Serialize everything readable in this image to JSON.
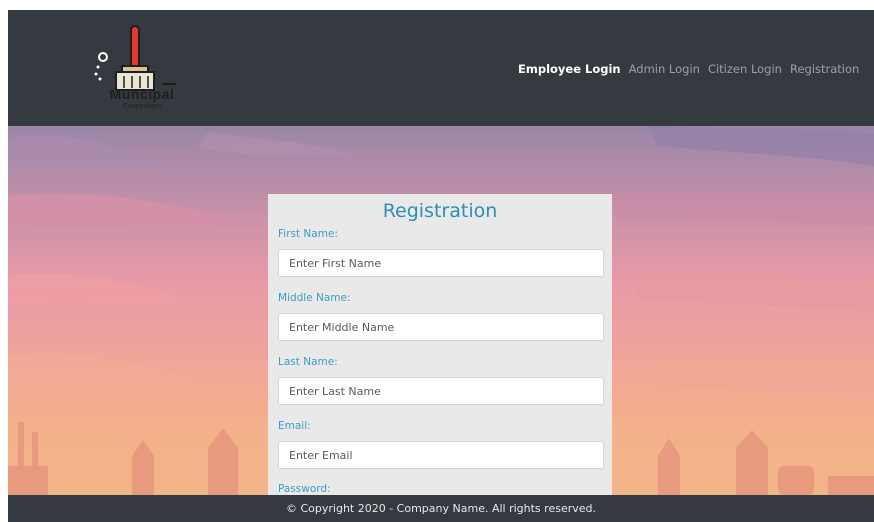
{
  "brand": {
    "logo_text": "Muncipal",
    "logo_subtext": "Cooperation"
  },
  "nav": {
    "items": [
      {
        "label": "Employee Login",
        "active": true
      },
      {
        "label": "Admin Login",
        "active": false
      },
      {
        "label": "Citizen Login",
        "active": false
      },
      {
        "label": "Registration",
        "active": false
      }
    ]
  },
  "form": {
    "title": "Registration",
    "fields": [
      {
        "label": "First Name:",
        "placeholder": "Enter First Name",
        "value": ""
      },
      {
        "label": "Middle Name:",
        "placeholder": "Enter Middle Name",
        "value": ""
      },
      {
        "label": "Last Name:",
        "placeholder": "Enter Last Name",
        "value": ""
      },
      {
        "label": "Email:",
        "placeholder": "Enter Email",
        "value": ""
      },
      {
        "label": "Password:",
        "placeholder": "",
        "value": ""
      }
    ]
  },
  "footer": {
    "text": "© Copyright 2020 - Company Name. All rights reserved."
  },
  "colors": {
    "navbar": "#353a40",
    "accent": "#2d8fb2",
    "label": "#3a9fc0",
    "card": "#e9e9e9"
  }
}
